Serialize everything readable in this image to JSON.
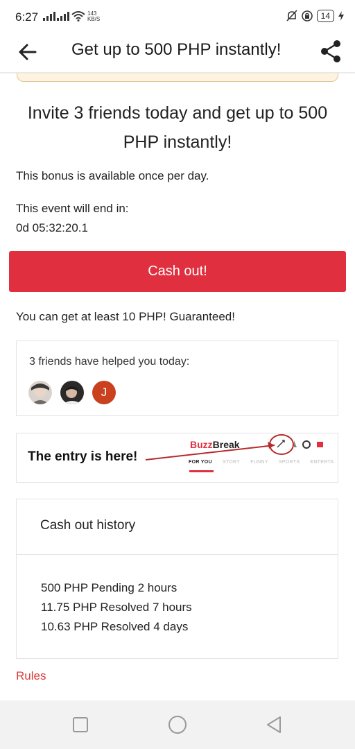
{
  "status_bar": {
    "time": "6:27",
    "net_speed_value": "143",
    "net_speed_unit": "KB/S",
    "battery": "14"
  },
  "app_bar": {
    "title": "Get up to 500 PHP instantly!",
    "back_icon": "arrow-left-icon",
    "share_icon": "share-icon"
  },
  "main": {
    "headline": "Invite 3 friends today and get up to 500 PHP instantly!",
    "bonus_note": "This bonus is available once per day.",
    "event_label": "This event will end in:",
    "countdown": "0d 05:32:20.1",
    "cash_out_label": "Cash out!",
    "guarantee_text": "You can get at least 10 PHP! Guaranteed!"
  },
  "friends": {
    "title": "3 friends have helped you today:",
    "avatars": [
      {
        "type": "photo"
      },
      {
        "type": "photo"
      },
      {
        "type": "initial",
        "initial": "J"
      }
    ]
  },
  "entry_hint": {
    "text": "The entry is here!",
    "logo_buzz": "Buzz",
    "logo_break": "Break",
    "tabs": [
      "FOR YOU",
      "STORY",
      "FUNNY",
      "SPORTS",
      "ENTERTA"
    ]
  },
  "history": {
    "title": "Cash out history",
    "items": [
      "500 PHP Pending 2 hours",
      "11.75 PHP Resolved 7 hours",
      "10.63 PHP Resolved 4 days"
    ]
  },
  "rules_label": "Rules",
  "colors": {
    "accent": "#e0303f",
    "link": "#d93b3b",
    "avatar_j": "#c9411f"
  }
}
